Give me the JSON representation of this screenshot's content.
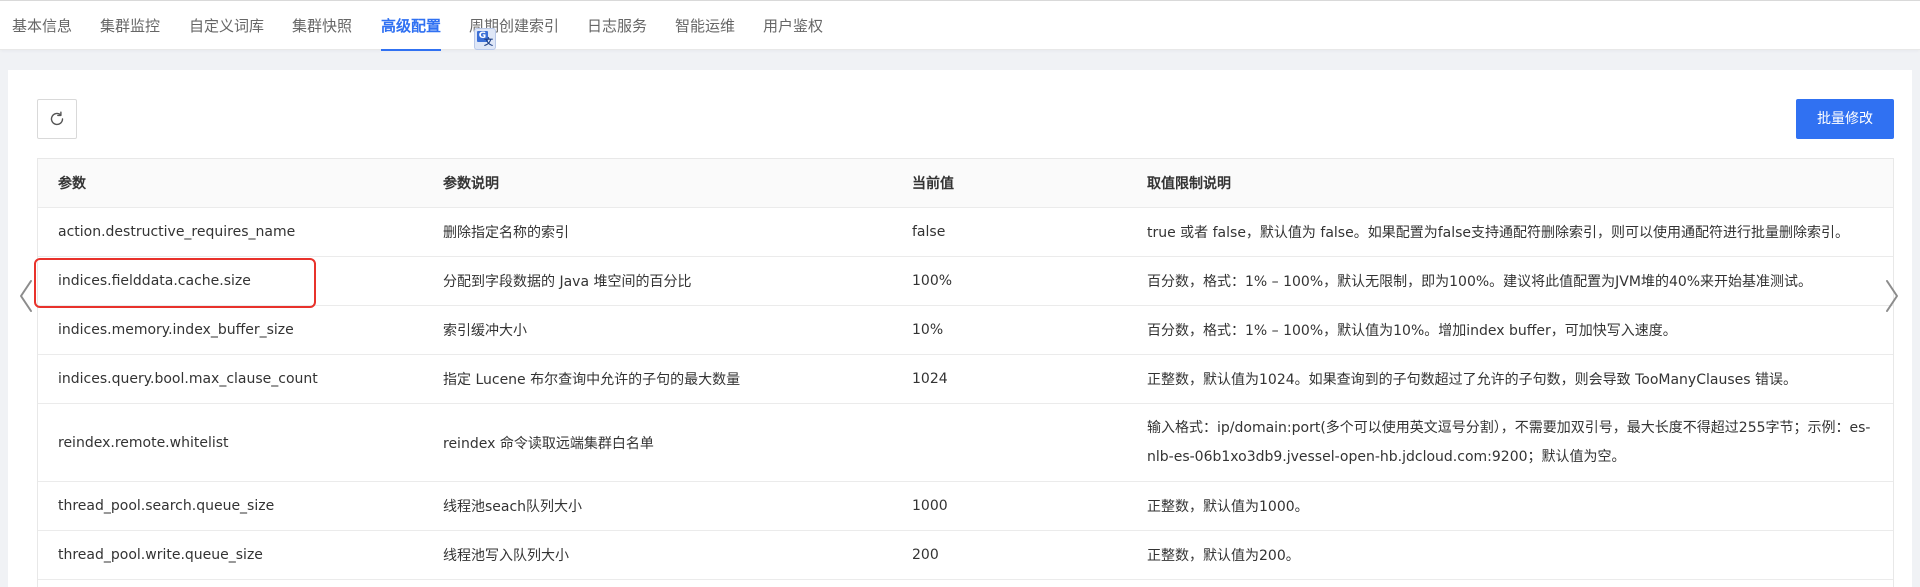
{
  "tabs": [
    {
      "label": "基本信息",
      "active": false
    },
    {
      "label": "集群监控",
      "active": false
    },
    {
      "label": "自定义词库",
      "active": false
    },
    {
      "label": "集群快照",
      "active": false
    },
    {
      "label": "高级配置",
      "active": true
    },
    {
      "label": "周期创建索引",
      "active": false
    },
    {
      "label": "日志服务",
      "active": false
    },
    {
      "label": "智能运维",
      "active": false
    },
    {
      "label": "用户鉴权",
      "active": false
    }
  ],
  "toolbar": {
    "refresh_icon": "refresh-icon",
    "batch_label": "批量修改"
  },
  "table": {
    "headers": [
      "参数",
      "参数说明",
      "当前值",
      "取值限制说明"
    ],
    "rows": [
      {
        "param": "action.destructive_requires_name",
        "desc": "删除指定名称的索引",
        "value": "false",
        "limit": "true 或者 false，默认值为 false。如果配置为false支持通配符删除索引，则可以使用通配符进行批量删除索引。"
      },
      {
        "param": "indices.fielddata.cache.size",
        "desc": "分配到字段数据的 Java 堆空间的百分比",
        "value": "100%",
        "limit": "百分数，格式：1% – 100%，默认无限制，即为100%。建议将此值配置为JVM堆的40%来开始基准测试。"
      },
      {
        "param": "indices.memory.index_buffer_size",
        "desc": "索引缓冲大小",
        "value": "10%",
        "limit": "百分数，格式：1% – 100%，默认值为10%。增加index buffer，可加快写入速度。"
      },
      {
        "param": "indices.query.bool.max_clause_count",
        "desc": "指定 Lucene 布尔查询中允许的子句的最大数量",
        "value": "1024",
        "limit": "正整数，默认值为1024。如果查询到的子句数超过了允许的子句数，则会导致 TooManyClauses 错误。"
      },
      {
        "param": "reindex.remote.whitelist",
        "desc": "reindex 命令读取远端集群白名单",
        "value": "",
        "limit": "输入格式：ip/domain:port(多个可以使用英文逗号分割），不需要加双引号，最大长度不得超过255字节；示例：es-nlb-es-06b1xo3db9.jvessel-open-hb.jdcloud.com:9200；默认值为空。"
      },
      {
        "param": "thread_pool.search.queue_size",
        "desc": "线程池seach队列大小",
        "value": "1000",
        "limit": "正整数，默认值为1000。"
      },
      {
        "param": "thread_pool.write.queue_size",
        "desc": "线程池写入队列大小",
        "value": "200",
        "limit": "正整数，默认值为200。"
      }
    ]
  },
  "colors": {
    "accent": "#3071f2",
    "highlight": "#e8322b"
  }
}
